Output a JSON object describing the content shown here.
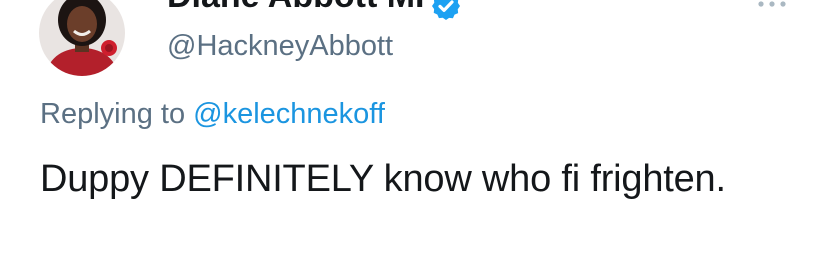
{
  "author": {
    "display_name": "Diane Abbott MP",
    "handle": "@HackneyAbbott"
  },
  "reply": {
    "prefix": "Replying to",
    "mention": "@kelechnekoff"
  },
  "tweet": {
    "text": "Duppy DEFINITELY know who fi frighten."
  },
  "icons": {
    "verified": "verified-badge-icon",
    "more": "more-options-icon"
  },
  "colors": {
    "link": "#1b95e0",
    "verified": "#1da1f2",
    "secondary_text": "#5b7083",
    "primary_text": "#14171a"
  }
}
